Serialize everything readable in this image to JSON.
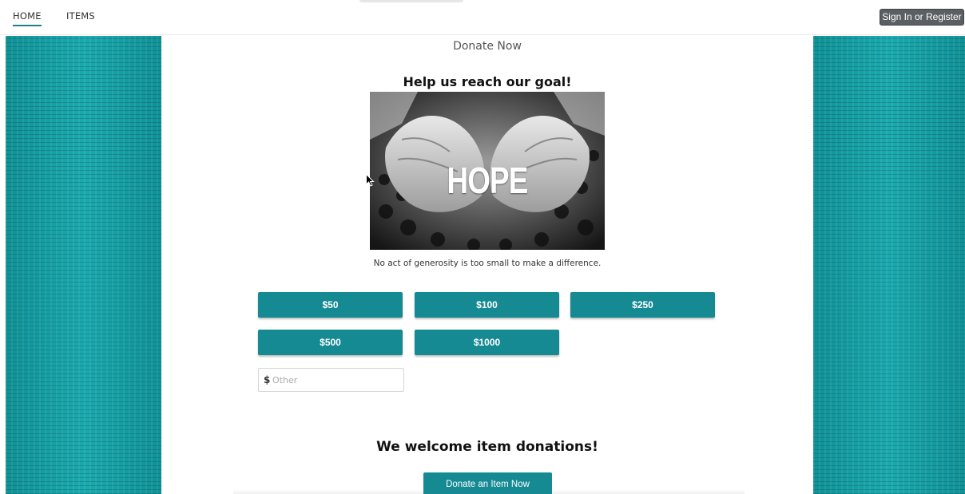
{
  "nav": {
    "home_label": "HOME",
    "items_label": "ITEMS",
    "signin_label": "Sign In or Register"
  },
  "donate": {
    "page_title": "Donate Now",
    "goal_heading": "Help us reach our goal!",
    "image_text": "HOPE",
    "caption": "No act of generosity is too small to make a difference.",
    "amounts": [
      "$50",
      "$100",
      "$250",
      "$500",
      "$1000"
    ],
    "other": {
      "currency_symbol": "$",
      "placeholder": "Other",
      "value": ""
    }
  },
  "items": {
    "heading": "We welcome item donations!",
    "button_label": "Donate an Item Now"
  },
  "colors": {
    "accent": "#168a93",
    "side_panel": "#149ea3",
    "signin_bg": "#5a5f63"
  }
}
